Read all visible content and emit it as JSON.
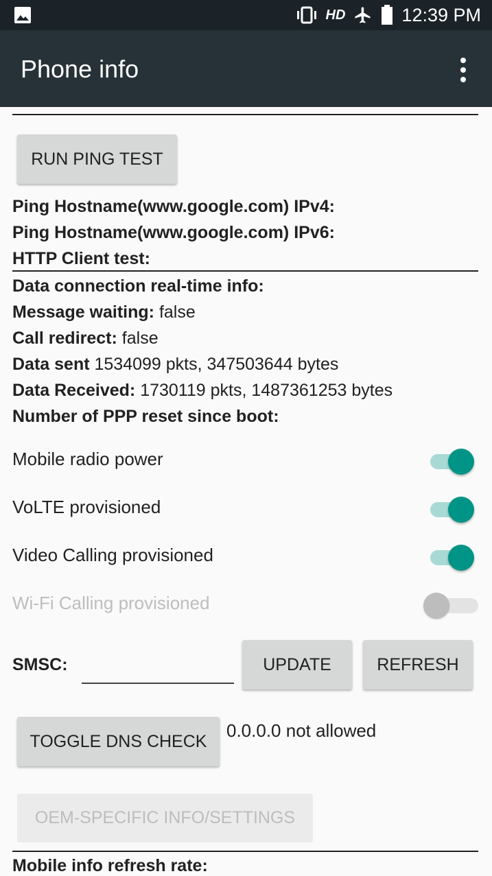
{
  "status_bar": {
    "left_icon": "image-icon",
    "icons": [
      "vibrate-icon",
      "hd-icon",
      "airplane-icon",
      "battery-icon"
    ],
    "hd_label": "HD",
    "time": "12:39 PM"
  },
  "app_bar": {
    "title": "Phone info",
    "menu_icon": "more-vert-icon"
  },
  "buttons": {
    "run_ping_test": "RUN PING TEST",
    "update": "UPDATE",
    "refresh": "REFRESH",
    "toggle_dns_check": "TOGGLE DNS CHECK",
    "oem_specific": "OEM-SPECIFIC INFO/SETTINGS"
  },
  "info": {
    "ping_ipv4_label": "Ping Hostname(www.google.com) IPv4:",
    "ping_ipv6_label": "Ping Hostname(www.google.com) IPv6:",
    "http_client_label": "HTTP Client test:",
    "data_conn_label": "Data connection real-time info:",
    "message_waiting_label": "Message waiting:",
    "message_waiting_value": "false",
    "call_redirect_label": "Call redirect:",
    "call_redirect_value": "false",
    "data_sent_label": "Data sent",
    "data_sent_value": "1534099 pkts, 347503644 bytes",
    "data_received_label": "Data Received:",
    "data_received_value": "1730119 pkts, 1487361253 bytes",
    "ppp_reset_label": "Number of PPP reset since boot:",
    "mobile_refresh_label": "Mobile info refresh rate:"
  },
  "switches": [
    {
      "label": "Mobile radio power",
      "on": true,
      "enabled": true
    },
    {
      "label": "VoLTE provisioned",
      "on": true,
      "enabled": true
    },
    {
      "label": "Video Calling provisioned",
      "on": true,
      "enabled": true
    },
    {
      "label": "Wi-Fi Calling provisioned",
      "on": false,
      "enabled": false
    }
  ],
  "smsc": {
    "label": "SMSC:",
    "value": ""
  },
  "dns": {
    "status": "0.0.0.0 not allowed"
  },
  "colors": {
    "status_bar": "#1b2329",
    "app_bar": "#263238",
    "accent": "#009486",
    "accent_track": "#a9d9d4"
  }
}
